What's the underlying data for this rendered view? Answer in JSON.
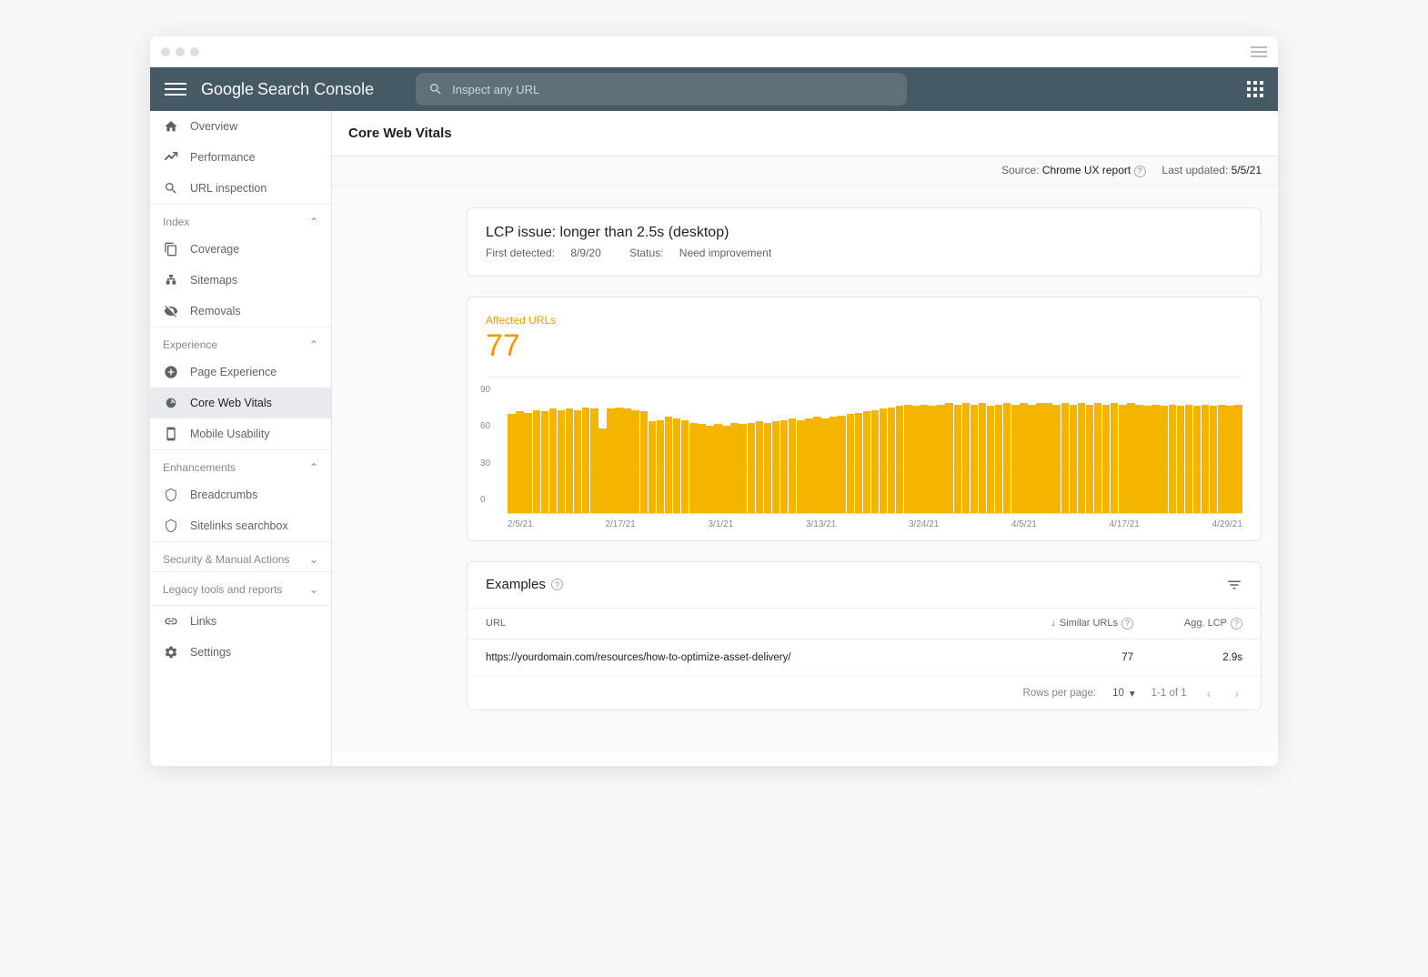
{
  "brand": {
    "google": "Google",
    "product": "Search Console"
  },
  "search": {
    "placeholder": "Inspect any URL"
  },
  "sidebar": {
    "items_top": [
      {
        "label": "Overview"
      },
      {
        "label": "Performance"
      },
      {
        "label": "URL inspection"
      }
    ],
    "section_index": {
      "title": "Index",
      "items": [
        {
          "label": "Coverage"
        },
        {
          "label": "Sitemaps"
        },
        {
          "label": "Removals"
        }
      ]
    },
    "section_experience": {
      "title": "Experience",
      "items": [
        {
          "label": "Page Experience"
        },
        {
          "label": "Core Web Vitals"
        },
        {
          "label": "Mobile Usability"
        }
      ]
    },
    "section_enhance": {
      "title": "Enhancements",
      "items": [
        {
          "label": "Breadcrumbs"
        },
        {
          "label": "Sitelinks searchbox"
        }
      ]
    },
    "section_security": {
      "title": "Security & Manual Actions"
    },
    "section_legacy": {
      "title": "Legacy tools and reports"
    },
    "items_bottom": [
      {
        "label": "Links"
      },
      {
        "label": "Settings"
      }
    ]
  },
  "page": {
    "title": "Core Web Vitals",
    "source_label": "Source:",
    "source_value": "Chrome UX report",
    "updated_label": "Last updated:",
    "updated_value": "5/5/21"
  },
  "issue": {
    "title": "LCP issue: longer than 2.5s (desktop)",
    "first_detected_label": "First detected:",
    "first_detected_value": "8/9/20",
    "status_label": "Status:",
    "status_value": "Need improvement"
  },
  "chart_data": {
    "type": "bar",
    "title": "Affected URLs",
    "current_value": "77",
    "ylabel": "",
    "ylim": [
      0,
      90
    ],
    "yticks": [
      "90",
      "60",
      "30",
      "0"
    ],
    "xticks": [
      "2/5/21",
      "2/17/21",
      "3/1/21",
      "3/13/21",
      "3/24/21",
      "4/5/21",
      "4/17/21",
      "4/29/21"
    ],
    "values": [
      70,
      72,
      71,
      73,
      72,
      74,
      73,
      74,
      73,
      75,
      74,
      60,
      74,
      75,
      74,
      73,
      72,
      65,
      66,
      68,
      67,
      66,
      64,
      63,
      62,
      63,
      62,
      64,
      63,
      64,
      65,
      64,
      65,
      66,
      67,
      66,
      67,
      68,
      67,
      68,
      69,
      70,
      71,
      72,
      73,
      74,
      75,
      76,
      77,
      76,
      77,
      76,
      77,
      78,
      77,
      78,
      77,
      78,
      76,
      77,
      78,
      77,
      78,
      77,
      78,
      78,
      77,
      78,
      77,
      78,
      77,
      78,
      77,
      78,
      77,
      78,
      77,
      76,
      77,
      76,
      77,
      76,
      77,
      76,
      77,
      76,
      77,
      76,
      77
    ]
  },
  "examples": {
    "title": "Examples",
    "columns": {
      "url": "URL",
      "similar": "Similar URLs",
      "lcp": "Agg. LCP"
    },
    "rows": [
      {
        "url": "https://yourdomain.com/resources/how-to-optimize-asset-delivery/",
        "similar": "77",
        "lcp": "2.9s"
      }
    ],
    "pager": {
      "rows_label": "Rows per page:",
      "rows_value": "10",
      "range": "1-1 of 1"
    }
  }
}
